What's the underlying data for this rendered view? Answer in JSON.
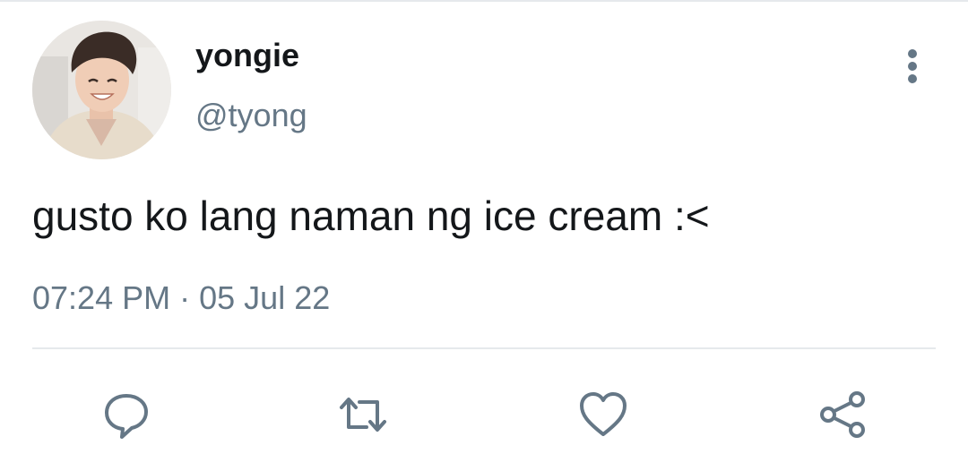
{
  "tweet": {
    "author": {
      "display_name": "yongie",
      "handle": "@tyong"
    },
    "text": "gusto ko lang naman ng ice cream :<",
    "time": "07:24 PM",
    "separator": "·",
    "date": "05 Jul 22"
  },
  "icons": {
    "more": "more-vertical-icon",
    "reply": "reply-icon",
    "retweet": "retweet-icon",
    "like": "heart-icon",
    "share": "share-icon"
  },
  "colors": {
    "text": "#14171a",
    "secondary": "#657786",
    "icon": "#657786",
    "divider": "#e6e9ec"
  }
}
